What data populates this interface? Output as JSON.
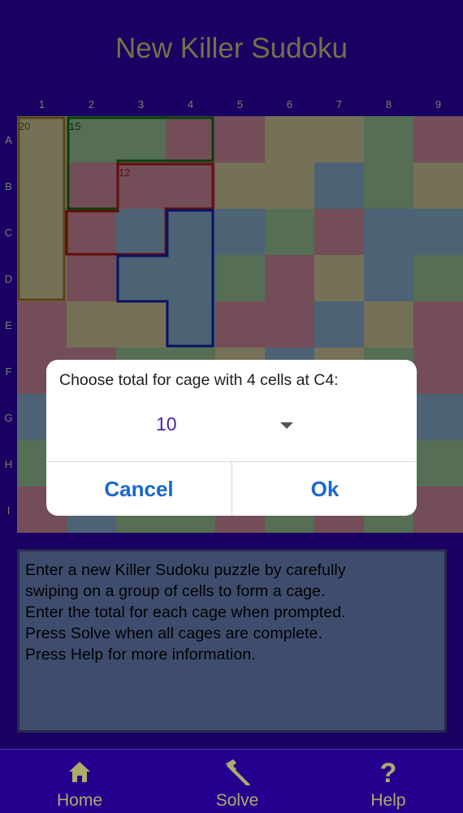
{
  "header": {
    "title": "New Killer Sudoku"
  },
  "grid": {
    "columns": [
      "1",
      "2",
      "3",
      "4",
      "5",
      "6",
      "7",
      "8",
      "9"
    ],
    "rows": [
      "A",
      "B",
      "C",
      "D",
      "E",
      "F",
      "G",
      "H",
      "I"
    ],
    "pattern": [
      "yggrryygr",
      "yrrryybgy",
      "yrbbbgrbb",
      "yrbbgrybg",
      "ryybrrbyr",
      "rrggybygr",
      "bbrybbbrb",
      "gyygrgbyg",
      "rbggrgrgr"
    ],
    "colors": {
      "y": "#a6a37b",
      "g": "#7a9e79",
      "r": "#a5707e",
      "b": "#6f8ea8"
    },
    "cages": [
      {
        "total": "20",
        "color": "#806020"
      },
      {
        "total": "15",
        "color": "#0d5a10"
      },
      {
        "total": "12",
        "color": "#8e1414"
      },
      {
        "total": "",
        "color": "#0d1a90"
      }
    ]
  },
  "instructions": {
    "lines": [
      "Enter a new Killer Sudoku puzzle by carefully",
      "swiping on a group of cells to form a cage.",
      "Enter the total for each cage when prompted.",
      "Press Solve when all cages are complete.",
      "Press Help for more information."
    ]
  },
  "dialog": {
    "title": "Choose total for cage with 4 cells at C4:",
    "selected_value": "10",
    "cancel_label": "Cancel",
    "ok_label": "Ok"
  },
  "nav": {
    "items": [
      {
        "label": "Home",
        "icon": "home-icon"
      },
      {
        "label": "Solve",
        "icon": "hammer-icon"
      },
      {
        "label": "Help",
        "icon": "question-icon"
      }
    ]
  }
}
